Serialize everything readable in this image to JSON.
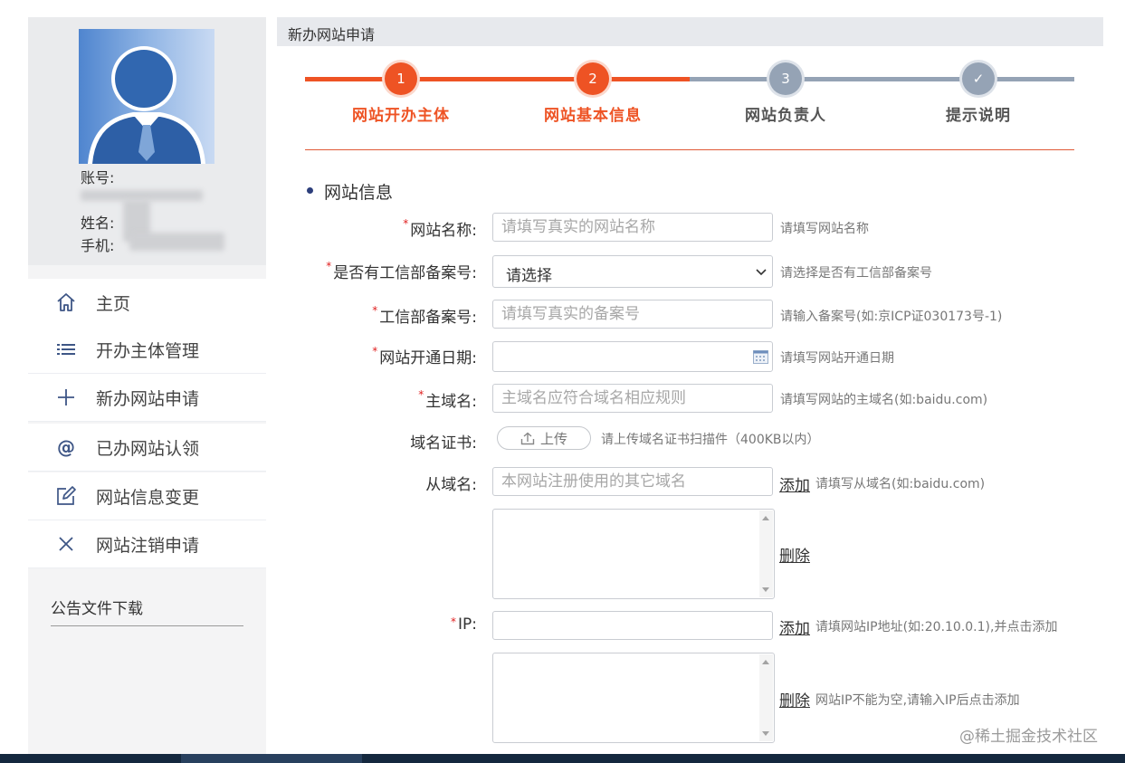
{
  "sidebar": {
    "profile": {
      "account_label": "账号:",
      "name_label": "姓名:",
      "phone_label": "手机:"
    },
    "nav": [
      {
        "label": "主页",
        "icon": "home-icon"
      },
      {
        "label": "开办主体管理",
        "icon": "list-icon"
      },
      {
        "label": "新办网站申请",
        "icon": "plus-icon"
      },
      {
        "label": "已办网站认领",
        "icon": "at-icon"
      },
      {
        "label": "网站信息变更",
        "icon": "edit-icon"
      },
      {
        "label": "网站注销申请",
        "icon": "close-icon"
      }
    ],
    "notice_title": "公告文件下载"
  },
  "main": {
    "title": "新办网站申请",
    "steps": [
      {
        "num": "1",
        "label": "网站开办主体",
        "status": "done"
      },
      {
        "num": "2",
        "label": "网站基本信息",
        "status": "done"
      },
      {
        "num": "3",
        "label": "网站负责人",
        "status": "todo"
      },
      {
        "num": "✓",
        "label": "提示说明",
        "status": "todo"
      }
    ],
    "section_title": "网站信息",
    "form": {
      "site_name": {
        "label": "网站名称:",
        "placeholder": "请填写真实的网站名称",
        "hint": "请填写网站名称"
      },
      "has_icp": {
        "label": "是否有工信部备案号:",
        "value": "请选择",
        "hint": "请选择是否有工信部备案号"
      },
      "icp_no": {
        "label": "工信部备案号:",
        "placeholder": "请填写真实的备案号",
        "hint": "请输入备案号(如:京ICP证030173号-1)"
      },
      "open_date": {
        "label": "网站开通日期:",
        "hint": "请填写网站开通日期"
      },
      "main_domain": {
        "label": "主域名:",
        "placeholder": "主域名应符合域名相应规则",
        "hint": "请填写网站的主域名(如:baidu.com)"
      },
      "domain_cert": {
        "label": "域名证书:",
        "button": "上传",
        "hint": "请上传域名证书扫描件（400KB以内）"
      },
      "sub_domain": {
        "label": "从域名:",
        "placeholder": "本网站注册使用的其它域名",
        "add": "添加",
        "hint": "请填写从域名(如:baidu.com)",
        "delete": "删除"
      },
      "ip": {
        "label": "IP:",
        "add": "添加",
        "hint": "请填网站IP地址(如:20.10.0.1),并点击添加",
        "delete": "删除",
        "delete_hint": "网站IP不能为空,请输入IP后点击添加"
      }
    },
    "colors": {
      "accent": "#ee5324",
      "pending": "#95a3b5",
      "nav_icon": "#3e5686"
    }
  },
  "watermark": "@稀土掘金技术社区"
}
